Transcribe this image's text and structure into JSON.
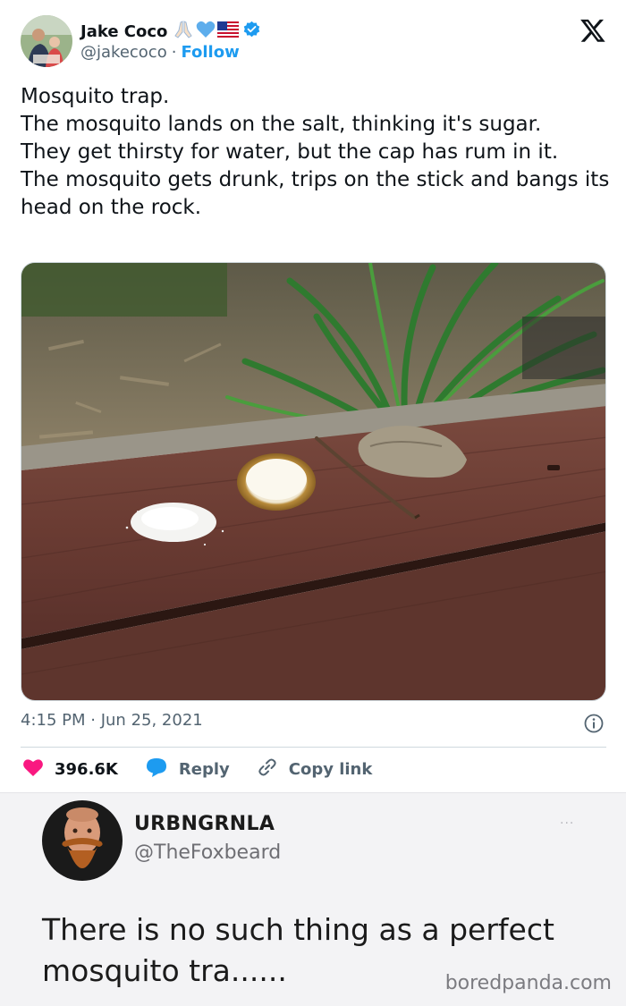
{
  "tweet": {
    "author_name": "Jake Coco",
    "handle": "@jakecoco",
    "separator": "·",
    "follow_label": "Follow",
    "text_lines": [
      "Mosquito trap.",
      "The mosquito lands on the salt, thinking it's sugar.",
      "They get thirsty for water, but the cap has rum in it.",
      "The mosquito gets drunk, trips on the stick and bangs its head on the rock."
    ],
    "time": "4:15 PM",
    "date": "Jun 25, 2021",
    "likes": "396.6K",
    "reply_label": "Reply",
    "copy_link_label": "Copy link",
    "icons": [
      "x-logo-icon",
      "verified-badge-icon",
      "info-icon",
      "heart-icon",
      "reply-bubble-icon",
      "link-icon"
    ]
  },
  "reply": {
    "name": "URBNGRNLA",
    "handle": "@TheFoxbeard",
    "dots": "...",
    "text": "There is no such thing as a perfect mosquito tra......"
  },
  "watermark": "boredpanda.com",
  "colors": {
    "link_blue": "#1d9bf0",
    "heart_pink": "#f91880",
    "text_dark": "#0f1419",
    "text_gray": "#536471"
  }
}
